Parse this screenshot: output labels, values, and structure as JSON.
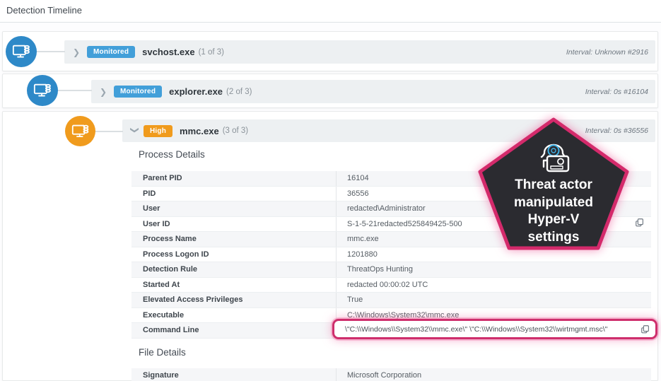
{
  "header": {
    "title": "Detection Timeline"
  },
  "timeline": {
    "rows": [
      {
        "badge": "Monitored",
        "name": "svchost.exe",
        "count": "(1 of 3)",
        "interval": "Interval: Unknown #2916"
      },
      {
        "badge": "Monitored",
        "name": "explorer.exe",
        "count": "(2 of 3)",
        "interval": "Interval: 0s #16104"
      },
      {
        "badge": "High",
        "name": "mmc.exe",
        "count": "(3 of 3)",
        "interval": "Interval: 0s #36556"
      }
    ]
  },
  "process_details": {
    "heading": "Process Details",
    "rows": [
      {
        "label": "Parent PID",
        "value": "16104"
      },
      {
        "label": "PID",
        "value": "36556"
      },
      {
        "label": "User",
        "value": "redacted\\Administrator"
      },
      {
        "label": "User ID",
        "value": "S-1-5-21redacted525849425-500"
      },
      {
        "label": "Process Name",
        "value": "mmc.exe"
      },
      {
        "label": "Process Logon ID",
        "value": "1201880"
      },
      {
        "label": "Detection Rule",
        "value": "ThreatOps Hunting"
      },
      {
        "label": "Started At",
        "value": "redacted 00:00:02 UTC"
      },
      {
        "label": "Elevated Access Privileges",
        "value": "True"
      },
      {
        "label": "Executable",
        "value": "C:\\Windows\\System32\\mmc.exe"
      },
      {
        "label": "Command Line",
        "value": "\\\"C:\\\\Windows\\\\System32\\\\mmc.exe\\\" \\\"C:\\\\Windows\\\\System32\\\\wirtmgmt.msc\\\""
      }
    ]
  },
  "file_details": {
    "heading": "File Details",
    "rows": [
      {
        "label": "Signature",
        "value": "Microsoft Corporation"
      }
    ]
  },
  "callout": {
    "text": "Threat actor manipulated Hyper-V settings",
    "lines": [
      "Threat actor",
      "manipulated",
      "Hyper-V",
      "settings"
    ]
  },
  "icons": {
    "node": "monitor-process-icon",
    "copy": "copy-icon",
    "callout": "hooded-threat-actor-icon"
  },
  "colors": {
    "monitored_badge": "#429fd9",
    "high_badge": "#f09b1d",
    "blue_node": "#2e89c8",
    "orange_node": "#f09b1d",
    "highlight_pink": "#ce2e6c",
    "callout_fill": "#2b2b30"
  }
}
